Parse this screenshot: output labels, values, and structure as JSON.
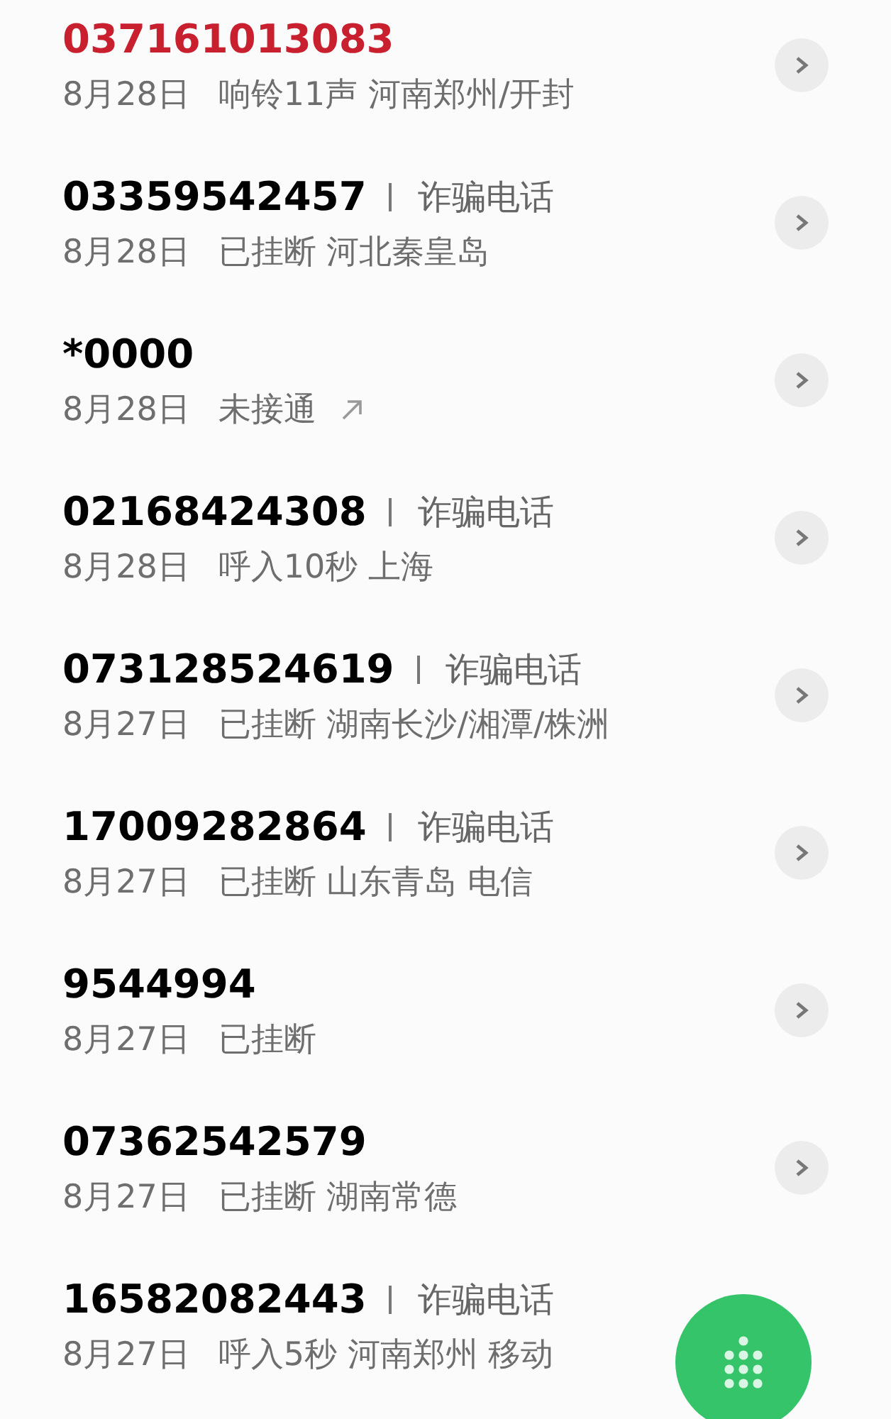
{
  "calls": [
    {
      "number": "037161013083",
      "missed": true,
      "date": "8月28日",
      "detail": "响铃11声 河南郑州/开封",
      "outgoing": false
    },
    {
      "number": "03359542457",
      "missed": false,
      "tag": "诈骗电话",
      "date": "8月28日",
      "detail": "已挂断 河北秦皇岛",
      "outgoing": false
    },
    {
      "number": "*0000",
      "missed": false,
      "date": "8月28日",
      "detail": "未接通",
      "outgoing": true
    },
    {
      "number": "02168424308",
      "missed": false,
      "tag": "诈骗电话",
      "date": "8月28日",
      "detail": "呼入10秒 上海",
      "outgoing": false
    },
    {
      "number": "073128524619",
      "missed": false,
      "tag": "诈骗电话",
      "date": "8月27日",
      "detail": "已挂断 湖南长沙/湘潭/株洲",
      "outgoing": false
    },
    {
      "number": "17009282864",
      "missed": false,
      "tag": "诈骗电话",
      "date": "8月27日",
      "detail": "已挂断 山东青岛 电信",
      "outgoing": false
    },
    {
      "number": "9544994",
      "missed": false,
      "date": "8月27日",
      "detail": "已挂断",
      "outgoing": false
    },
    {
      "number": "07362542579",
      "missed": false,
      "date": "8月27日",
      "detail": "已挂断 湖南常德",
      "outgoing": false
    },
    {
      "number": "16582082443",
      "missed": false,
      "tag": "诈骗电话",
      "date": "8月27日",
      "detail": "呼入5秒 河南郑州 移动",
      "outgoing": false
    }
  ]
}
